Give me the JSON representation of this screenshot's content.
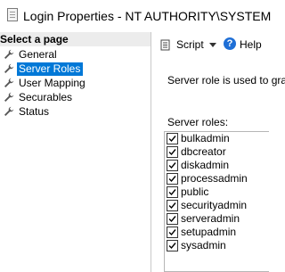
{
  "window": {
    "title": "Login Properties - NT AUTHORITY\\SYSTEM"
  },
  "left_pane": {
    "header": "Select a page",
    "items": [
      {
        "label": "General",
        "selected": false
      },
      {
        "label": "Server Roles",
        "selected": true
      },
      {
        "label": "User Mapping",
        "selected": false
      },
      {
        "label": "Securables",
        "selected": false
      },
      {
        "label": "Status",
        "selected": false
      }
    ]
  },
  "toolbar": {
    "script_label": "Script",
    "help_label": "Help",
    "help_glyph": "?"
  },
  "content": {
    "description": "Server role is used to gra",
    "roles_label": "Server roles:",
    "roles": [
      {
        "name": "bulkadmin",
        "checked": true
      },
      {
        "name": "dbcreator",
        "checked": true
      },
      {
        "name": "diskadmin",
        "checked": true
      },
      {
        "name": "processadmin",
        "checked": true
      },
      {
        "name": "public",
        "checked": true
      },
      {
        "name": "securityadmin",
        "checked": true
      },
      {
        "name": "serveradmin",
        "checked": true
      },
      {
        "name": "setupadmin",
        "checked": true
      },
      {
        "name": "sysadmin",
        "checked": true
      }
    ]
  }
}
